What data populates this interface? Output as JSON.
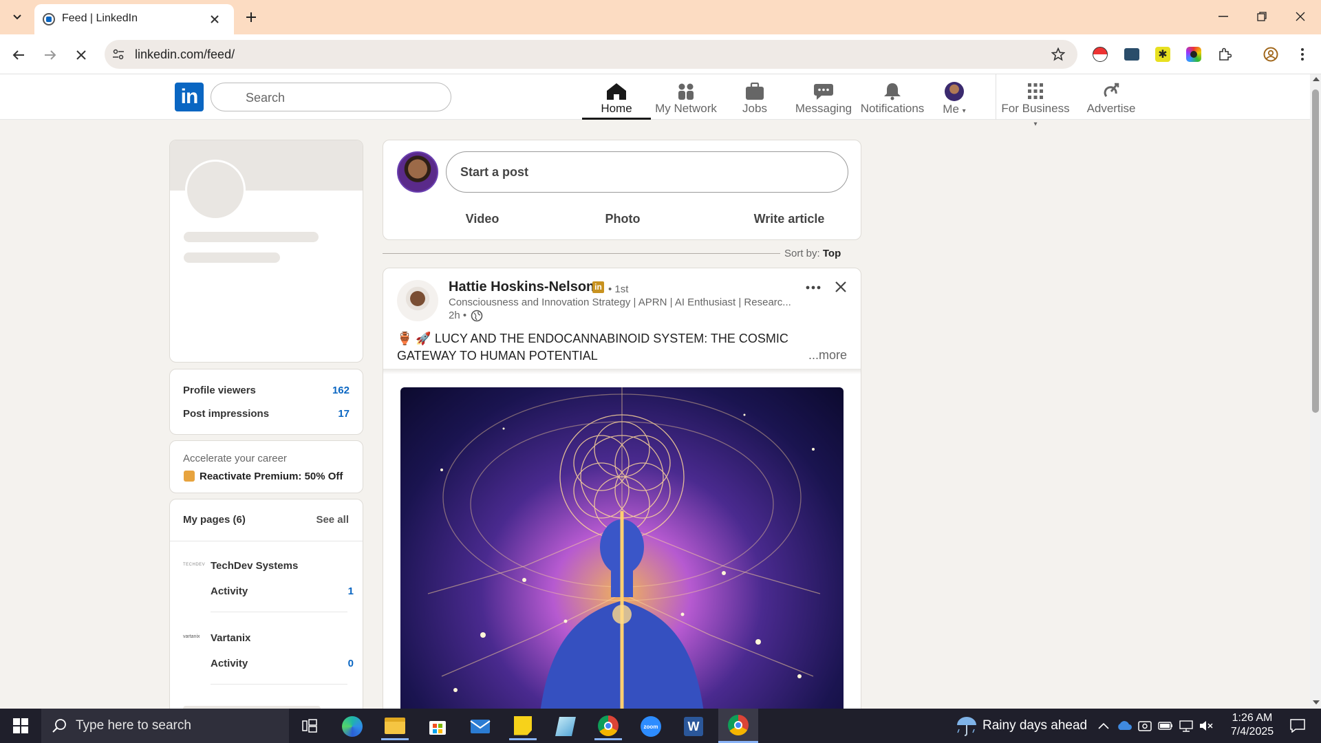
{
  "browser": {
    "tab_title": "Feed | LinkedIn",
    "url": "linkedin.com/feed/"
  },
  "linkedin": {
    "search_placeholder": "Search",
    "nav": [
      {
        "label": "Home"
      },
      {
        "label": "My Network"
      },
      {
        "label": "Jobs"
      },
      {
        "label": "Messaging"
      },
      {
        "label": "Notifications"
      },
      {
        "label": "Me"
      },
      {
        "label": "For Business"
      },
      {
        "label": "Advertise"
      }
    ]
  },
  "sidebar": {
    "stats": [
      {
        "label": "Profile viewers",
        "value": "162"
      },
      {
        "label": "Post impressions",
        "value": "17"
      }
    ],
    "premium": {
      "caption": "Accelerate your career",
      "cta": "Reactivate Premium: 50% Off"
    },
    "pages": {
      "title": "My pages (6)",
      "see_all": "See all",
      "items": [
        {
          "name": "TechDev Systems",
          "logo_text": "TECHDEV",
          "activity_label": "Activity",
          "activity_value": "1"
        },
        {
          "name": "Vartanix",
          "logo_text": "vartanix",
          "activity_label": "Activity",
          "activity_value": "0"
        }
      ]
    }
  },
  "composer": {
    "placeholder": "Start a post",
    "actions": [
      "Video",
      "Photo",
      "Write article"
    ]
  },
  "sort": {
    "label": "Sort by:",
    "value": "Top"
  },
  "post": {
    "author": "Hattie Hoskins-Nelson",
    "degree": "• 1st",
    "headline": "Consciousness and Innovation Strategy | APRN | AI Enthusiast | Researc...",
    "time": "2h •",
    "text": "🏺 🚀 LUCY AND THE ENDOCANNABINOID SYSTEM: THE COSMIC GATEWAY TO HUMAN POTENTIAL",
    "more": "...more"
  },
  "taskbar": {
    "search_placeholder": "Type here to search",
    "weather": "Rainy days ahead",
    "time": "1:26 AM",
    "date": "7/4/2025"
  },
  "colors": {
    "brand": "#0a66c2",
    "tabbar": "#fcdcc2",
    "taskbar": "#1f1f2b"
  }
}
